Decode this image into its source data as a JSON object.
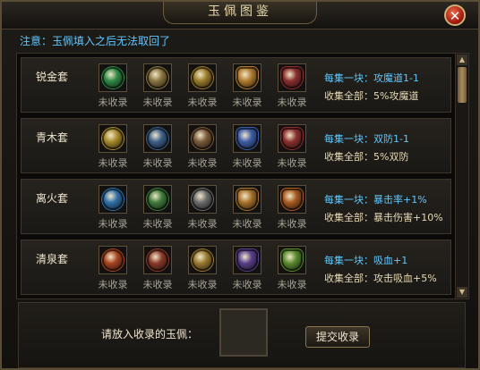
{
  "title": "玉佩图鉴",
  "close_label": "✕",
  "notice": "注意：玉佩填入之后无法取回了",
  "sets": [
    {
      "name": "锐金套",
      "items": [
        {
          "label": "未收录",
          "icon": "green-jade-icon",
          "color": "#2e8a45"
        },
        {
          "label": "未收录",
          "icon": "bronze-dragon-jade-icon",
          "color": "#8a7440"
        },
        {
          "label": "未收录",
          "icon": "gold-lion-jade-icon",
          "color": "#9a7b2a"
        },
        {
          "label": "未收录",
          "icon": "ornate-gold-jade-icon",
          "color": "#b07b2e"
        },
        {
          "label": "未收录",
          "icon": "crimson-crest-jade-icon",
          "color": "#8a2e2e"
        }
      ],
      "each_label": "每集一块：",
      "each_value": "攻魔道1-1",
      "all_label": "收集全部：",
      "all_value": "5%攻魔道"
    },
    {
      "name": "青木套",
      "items": [
        {
          "label": "未收录",
          "icon": "yellow-jade-icon",
          "color": "#a88a2a"
        },
        {
          "label": "未收录",
          "icon": "blue-dragon-jade-icon",
          "color": "#3d5f8a"
        },
        {
          "label": "未收录",
          "icon": "phoenix-jade-icon",
          "color": "#7a5a3a"
        },
        {
          "label": "未收录",
          "icon": "blue-crest-jade-icon",
          "color": "#3e5da8"
        },
        {
          "label": "未收录",
          "icon": "red-crest-jade-icon",
          "color": "#8a3030"
        }
      ],
      "each_label": "每集一块：",
      "each_value": "双防1-1",
      "all_label": "收集全部：",
      "all_value": "5%双防"
    },
    {
      "name": "离火套",
      "items": [
        {
          "label": "未收录",
          "icon": "blue-jade-icon",
          "color": "#2f6fa8"
        },
        {
          "label": "未收录",
          "icon": "green-dragon-jade-icon",
          "color": "#3f7a3a"
        },
        {
          "label": "未收录",
          "icon": "silver-jade-icon",
          "color": "#6b6b6b"
        },
        {
          "label": "未收录",
          "icon": "amber-crest-jade-icon",
          "color": "#a8722a"
        },
        {
          "label": "未收录",
          "icon": "orange-crest-jade-icon",
          "color": "#a85a20"
        }
      ],
      "each_label": "每集一块：",
      "each_value": "暴击率+1%",
      "all_label": "收集全部：",
      "all_value": "暴击伤害+10%"
    },
    {
      "name": "清泉套",
      "items": [
        {
          "label": "未收录",
          "icon": "red-dragon-jade-icon",
          "color": "#a8441e"
        },
        {
          "label": "未收录",
          "icon": "red-round-jade-icon",
          "color": "#8a3a2a"
        },
        {
          "label": "未收录",
          "icon": "gold-round-jade-icon",
          "color": "#9a7a2e"
        },
        {
          "label": "未收录",
          "icon": "purple-crest-jade-icon",
          "color": "#5a3f8a"
        },
        {
          "label": "未收录",
          "icon": "green-crest-jade-icon",
          "color": "#5a8a2e"
        }
      ],
      "each_label": "每集一块：",
      "each_value": "吸血+1",
      "all_label": "收集全部：",
      "all_value": "攻击吸血+5%"
    }
  ],
  "drop_label": "请放入收录的玉佩：",
  "submit_label": "提交收录"
}
